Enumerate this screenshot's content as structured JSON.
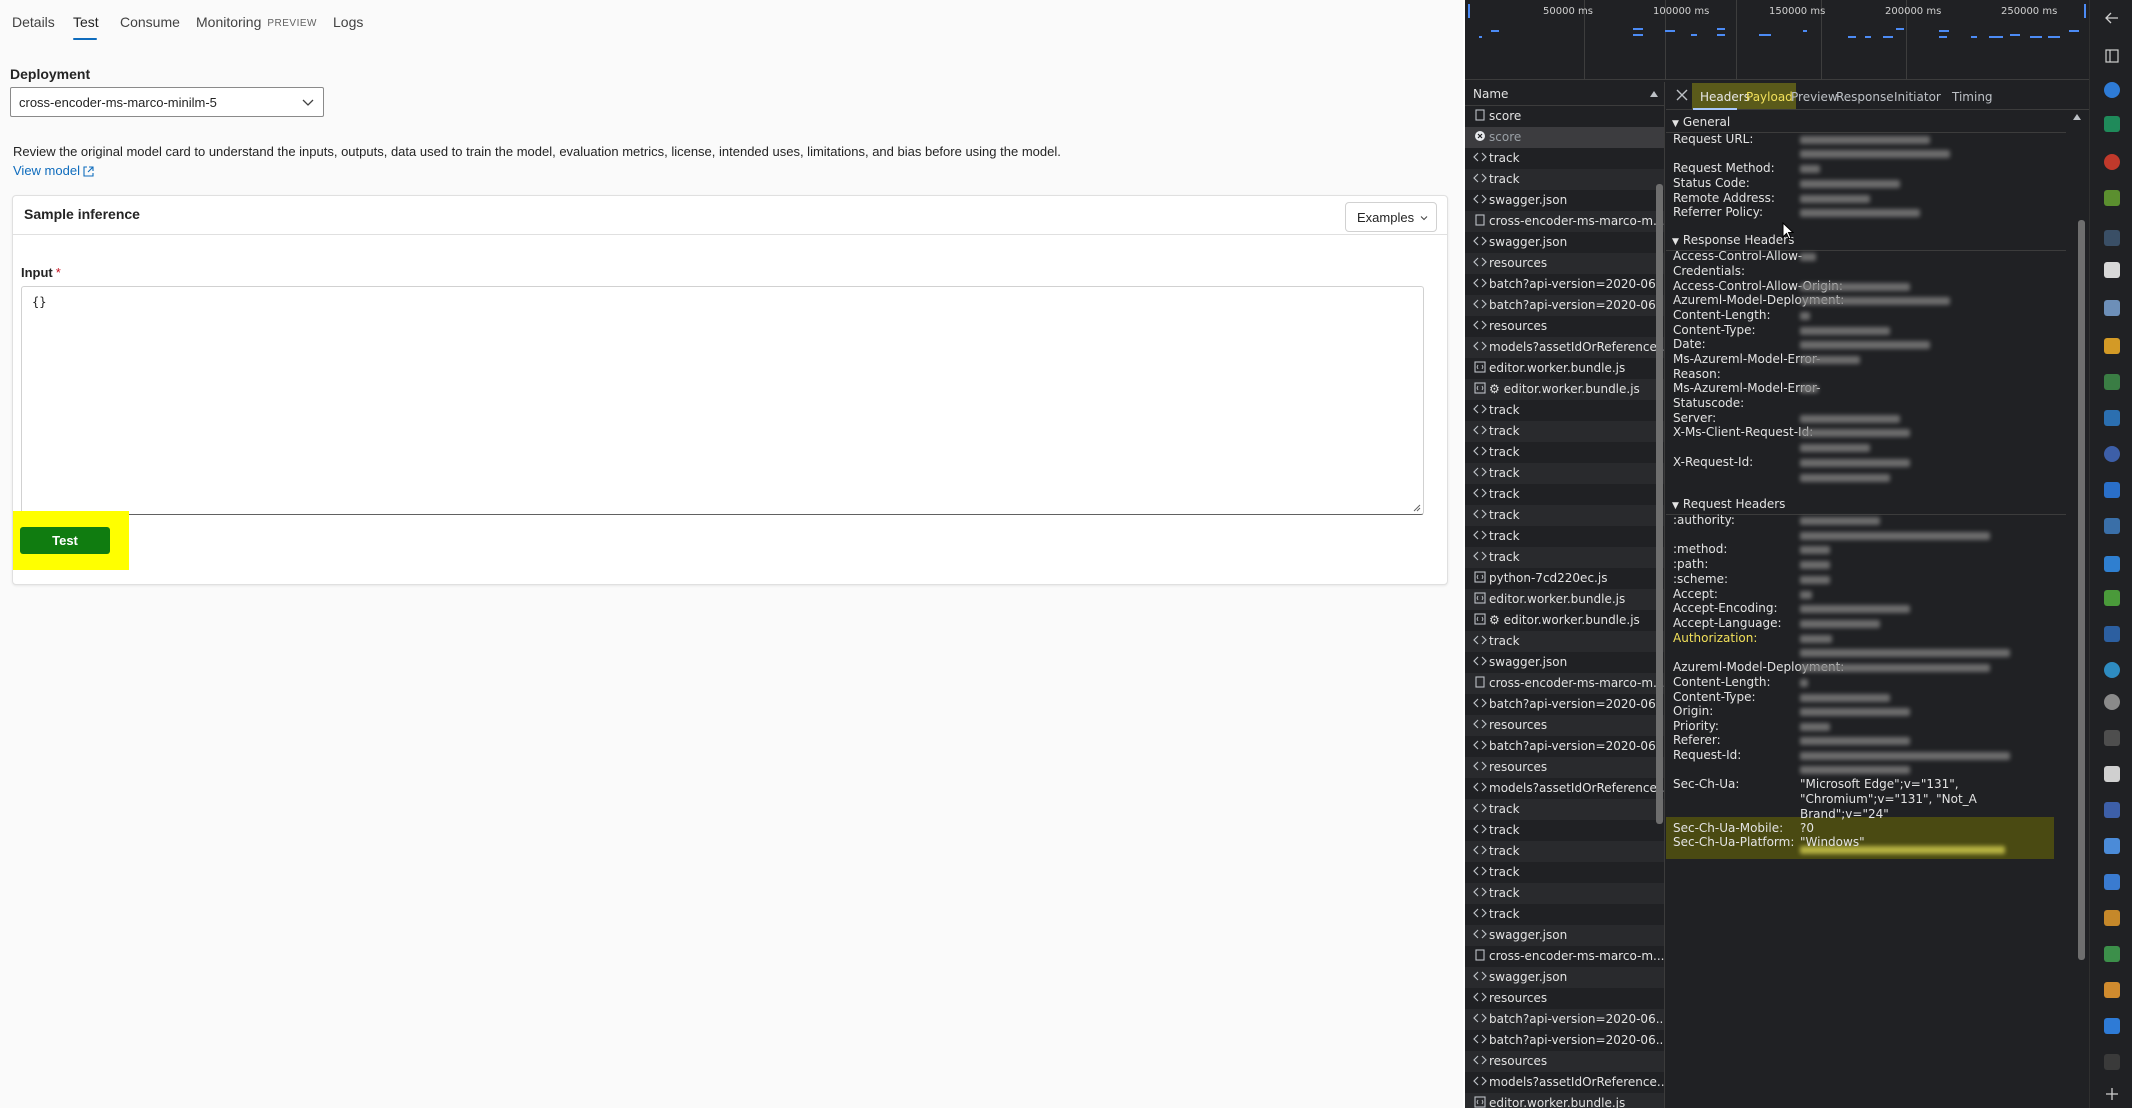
{
  "app": {
    "tabs": [
      {
        "label": "Details"
      },
      {
        "label": "Test",
        "active": true
      },
      {
        "label": "Consume"
      },
      {
        "label": "Monitoring",
        "badge": "PREVIEW"
      },
      {
        "label": "Logs"
      }
    ],
    "deployment_label": "Deployment",
    "deployment_value": "cross-encoder-ms-marco-minilm-5",
    "description": "Review the original model card to understand the inputs, outputs, data used to train the model, evaluation metrics, license, intended uses, limitations, and bias before using the model.",
    "view_model_link": "View model",
    "sample_inference_title": "Sample inference",
    "examples_button": "Examples",
    "input_label": "Input",
    "input_required_mark": "*",
    "input_value": "{}",
    "test_button": "Test",
    "highlight_color": "#ffff00",
    "accent_color": "#0f6cbd",
    "test_button_color": "#107c10"
  },
  "devtools": {
    "timeline_labels": [
      "50000 ms",
      "100000 ms",
      "150000 ms",
      "200000 ms",
      "250000 ms"
    ],
    "name_header": "Name",
    "requests": [
      {
        "name": "score",
        "icon": "doc-icon"
      },
      {
        "name": "score",
        "icon": "error-icon",
        "selected": true
      },
      {
        "name": "track",
        "icon": "fetch-icon"
      },
      {
        "name": "track",
        "icon": "fetch-icon"
      },
      {
        "name": "swagger.json",
        "icon": "fetch-icon"
      },
      {
        "name": "cross-encoder-ms-marco-m...",
        "icon": "doc-icon"
      },
      {
        "name": "swagger.json",
        "icon": "fetch-icon"
      },
      {
        "name": "resources",
        "icon": "fetch-icon"
      },
      {
        "name": "batch?api-version=2020-06...",
        "icon": "fetch-icon"
      },
      {
        "name": "batch?api-version=2020-06...",
        "icon": "fetch-icon"
      },
      {
        "name": "resources",
        "icon": "fetch-icon"
      },
      {
        "name": "models?assetIdOrReference...",
        "icon": "fetch-icon"
      },
      {
        "name": "editor.worker.bundle.js",
        "icon": "script-icon"
      },
      {
        "name": "⚙ editor.worker.bundle.js",
        "icon": "script-icon"
      },
      {
        "name": "track",
        "icon": "fetch-icon"
      },
      {
        "name": "track",
        "icon": "fetch-icon"
      },
      {
        "name": "track",
        "icon": "fetch-icon"
      },
      {
        "name": "track",
        "icon": "fetch-icon"
      },
      {
        "name": "track",
        "icon": "fetch-icon"
      },
      {
        "name": "track",
        "icon": "fetch-icon"
      },
      {
        "name": "track",
        "icon": "fetch-icon"
      },
      {
        "name": "track",
        "icon": "fetch-icon"
      },
      {
        "name": "python-7cd220ec.js",
        "icon": "script-icon"
      },
      {
        "name": "editor.worker.bundle.js",
        "icon": "script-icon"
      },
      {
        "name": "⚙ editor.worker.bundle.js",
        "icon": "script-icon"
      },
      {
        "name": "track",
        "icon": "fetch-icon"
      },
      {
        "name": "swagger.json",
        "icon": "fetch-icon"
      },
      {
        "name": "cross-encoder-ms-marco-m...",
        "icon": "doc-icon"
      },
      {
        "name": "batch?api-version=2020-06...",
        "icon": "fetch-icon"
      },
      {
        "name": "resources",
        "icon": "fetch-icon"
      },
      {
        "name": "batch?api-version=2020-06...",
        "icon": "fetch-icon"
      },
      {
        "name": "resources",
        "icon": "fetch-icon"
      },
      {
        "name": "models?assetIdOrReference...",
        "icon": "fetch-icon"
      },
      {
        "name": "track",
        "icon": "fetch-icon"
      },
      {
        "name": "track",
        "icon": "fetch-icon"
      },
      {
        "name": "track",
        "icon": "fetch-icon"
      },
      {
        "name": "track",
        "icon": "fetch-icon"
      },
      {
        "name": "track",
        "icon": "fetch-icon"
      },
      {
        "name": "track",
        "icon": "fetch-icon"
      },
      {
        "name": "swagger.json",
        "icon": "fetch-icon"
      },
      {
        "name": "cross-encoder-ms-marco-m...",
        "icon": "doc-icon"
      },
      {
        "name": "swagger.json",
        "icon": "fetch-icon"
      },
      {
        "name": "resources",
        "icon": "fetch-icon"
      },
      {
        "name": "batch?api-version=2020-06...",
        "icon": "fetch-icon"
      },
      {
        "name": "batch?api-version=2020-06...",
        "icon": "fetch-icon"
      },
      {
        "name": "resources",
        "icon": "fetch-icon"
      },
      {
        "name": "models?assetIdOrReference...",
        "icon": "fetch-icon"
      },
      {
        "name": "editor.worker.bundle.js",
        "icon": "script-icon"
      }
    ],
    "detail_tabs": [
      "Headers",
      "Payload",
      "Preview",
      "Response",
      "Initiator",
      "Timing"
    ],
    "sections": {
      "general": "General",
      "response_headers": "Response Headers",
      "request_headers": "Request Headers"
    },
    "general_keys": [
      "Request URL:",
      "Request Method:",
      "Status Code:",
      "Remote Address:",
      "Referrer Policy:"
    ],
    "response_keys": [
      "Access-Control-Allow-",
      "Credentials:",
      "Access-Control-Allow-Origin:",
      "Azureml-Model-Deployment:",
      "Content-Length:",
      "Content-Type:",
      "Date:",
      "Ms-Azureml-Model-Error-",
      "Reason:",
      "Ms-Azureml-Model-Error-",
      "Statuscode:",
      "Server:",
      "X-Ms-Client-Request-Id:",
      "X-Request-Id:"
    ],
    "request_keys": [
      ":authority:",
      ":method:",
      ":path:",
      ":scheme:",
      "Accept:",
      "Accept-Encoding:",
      "Accept-Language:",
      "Authorization:",
      "Azureml-Model-Deployment:",
      "Content-Length:",
      "Content-Type:",
      "Origin:",
      "Priority:",
      "Referer:",
      "Request-Id:",
      "Sec-Ch-Ua:",
      "Sec-Ch-Ua-Mobile:",
      "Sec-Ch-Ua-Platform:"
    ],
    "sec_ch_ua_lines": [
      "\"Microsoft Edge\";v=\"131\",",
      "\"Chromium\";v=\"131\", \"Not_A",
      "Brand\";v=\"24\""
    ],
    "sec_ch_ua_mobile": "?0",
    "sec_ch_ua_platform": "\"Windows\"",
    "highlight_color": "#5a5a1a"
  }
}
